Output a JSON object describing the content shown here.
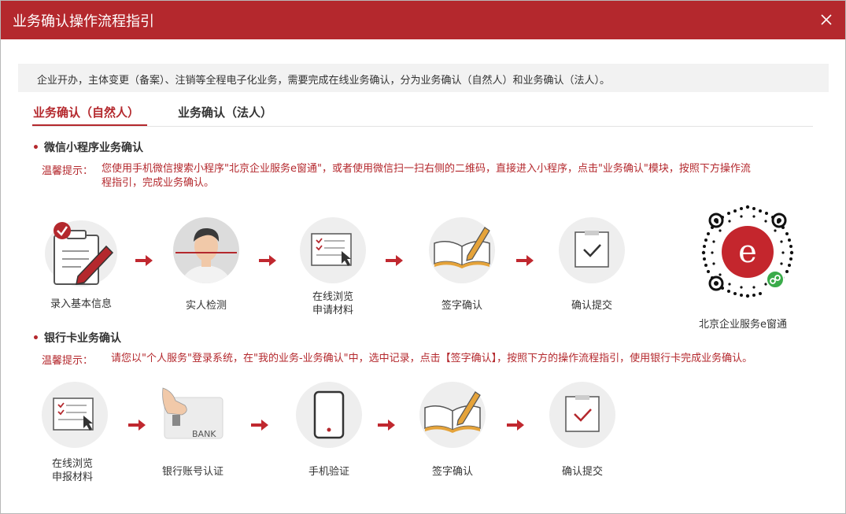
{
  "dialog": {
    "title": "业务确认操作流程指引",
    "close_icon": "close-icon"
  },
  "notice": "企业开办，主体变更（备案）、注销等全程电子化业务，需要完成在线业务确认，分为业务确认（自然人）和业务确认（法人）。",
  "tabs": [
    {
      "label": "业务确认（自然人）",
      "active": true
    },
    {
      "label": "业务确认（法人）",
      "active": false
    }
  ],
  "wechat_section": {
    "title": "微信小程序业务确认",
    "hint_label": "温馨提示：",
    "hint_line1": "您使用手机微信搜索小程序\"北京企业服务e窗通\"，或者使用微信扫一扫右侧的二维码，直接进入小程序，点击\"业务确认\"模块，按照下方操作流",
    "hint_line2": "程指引，完成业务确认。",
    "steps": [
      {
        "label": "录入基本信息",
        "icon": "clipboard-pen-icon"
      },
      {
        "label": "实人检测",
        "icon": "face-detection-icon"
      },
      {
        "label_line1": "在线浏览",
        "label_line2": "申请材料",
        "icon": "document-cursor-icon"
      },
      {
        "label": "签字确认",
        "icon": "book-pen-icon"
      },
      {
        "label": "确认提交",
        "icon": "checkbox-icon"
      }
    ],
    "qr_label": "北京企业服务e窗通",
    "qr_icon": "qr-code-icon"
  },
  "bank_section": {
    "title": "银行卡业务确认",
    "hint_label": "温馨提示：",
    "hint_text": "请您以\"个人服务\"登录系统，在\"我的业务-业务确认\"中，选中记录，点击【签字确认】，按照下方的操作流程指引，使用银行卡完成业务确认。",
    "steps": [
      {
        "label_line1": "在线浏览",
        "label_line2": "申报材料",
        "icon": "document-cursor-icon"
      },
      {
        "label": "银行账号认证",
        "icon": "bank-card-icon",
        "card_text": "BANK"
      },
      {
        "label": "手机验证",
        "icon": "phone-icon"
      },
      {
        "label": "签字确认",
        "icon": "book-pen-icon"
      },
      {
        "label": "确认提交",
        "icon": "checkbox-icon"
      }
    ]
  },
  "colors": {
    "accent": "#b4282d",
    "arrow": "#c0282f",
    "circle_bg": "#eeeeee"
  }
}
